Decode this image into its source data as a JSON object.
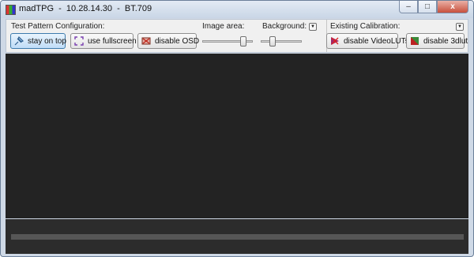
{
  "window": {
    "title": "madTPG  -  10.28.14.30  -  BT.709",
    "buttons": {
      "minimize": "–",
      "maximize": "□",
      "close": "x"
    }
  },
  "toolbar": {
    "test_pattern_label": "Test Pattern Configuration:",
    "stay_on_top": "stay on top",
    "use_fullscreen": "use fullscreen",
    "disable_osd": "disable OSD",
    "image_area_label": "Image area:",
    "image_area_level": 0.85,
    "background_label": "Background:",
    "background_level": 0.25,
    "dropdown_glyph": "▼",
    "existing_calibration_label": "Existing Calibration:",
    "disable_videoluts": "disable VideoLUTs",
    "disable_3dlut": "disable 3dlut"
  },
  "colors": {
    "window_frame": "#cfd9e6",
    "toolbar_bg": "#f0f0f0",
    "pattern_bg": "#232323",
    "progress_bg": "#2c2c2c",
    "progress_bar": "#565656",
    "active_button": "#bfdcf7"
  }
}
